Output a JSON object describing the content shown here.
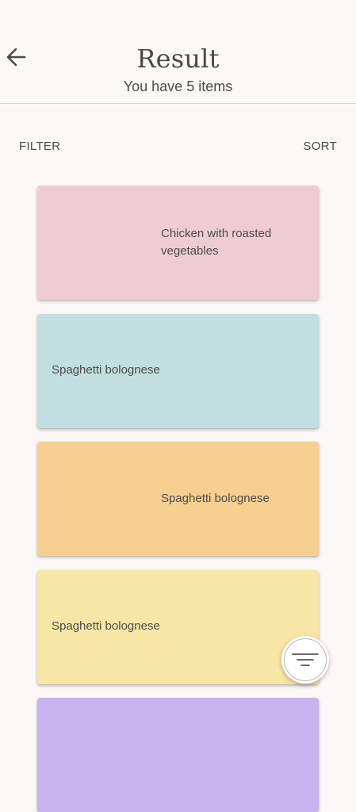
{
  "header": {
    "title": "Result",
    "subtitle": "You have 5 items",
    "back_icon": "arrow-left-icon"
  },
  "controls": {
    "filter_label": "FILTER",
    "sort_label": "SORT"
  },
  "cards": [
    {
      "label": "Chicken with roasted vegetables",
      "color": "#efccd3"
    },
    {
      "label": "Spaghetti bolognese",
      "color": "#c1dfe1"
    },
    {
      "label": "Spaghetti bolognese",
      "color": "#f7cf91"
    },
    {
      "label": "Spaghetti bolognese",
      "color": "#f8e6a6"
    },
    {
      "label": "",
      "color": "#c7b3ef"
    }
  ],
  "fab": {
    "icon": "filter-lines-icon"
  }
}
